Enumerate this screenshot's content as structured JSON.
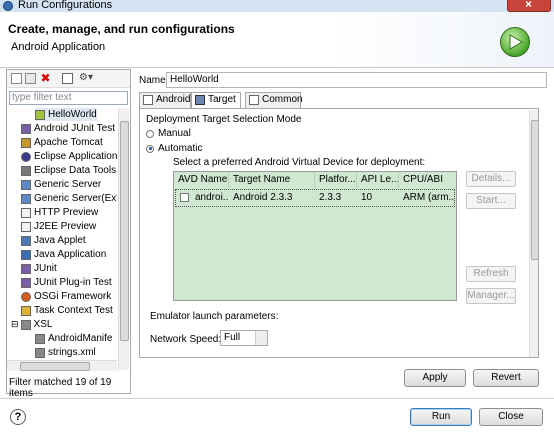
{
  "window": {
    "title": "Run Configurations"
  },
  "header": {
    "title": "Create, manage, and run configurations",
    "subtitle": "Android Application",
    "icon": "run-icon"
  },
  "sidebar": {
    "filter_placeholder": "type filter text",
    "toolbar_icons": [
      "new-config-icon",
      "duplicate-icon",
      "delete-icon",
      "collapse-all-icon",
      "filter-icon"
    ],
    "items": [
      {
        "label": "HelloWorld",
        "icon": "android-app-icon",
        "indent": 2,
        "selected": true
      },
      {
        "label": "Android JUnit Test",
        "icon": "junit-icon",
        "indent": 1
      },
      {
        "label": "Apache Tomcat",
        "icon": "tomcat-icon",
        "indent": 1
      },
      {
        "label": "Eclipse Application",
        "icon": "eclipse-icon",
        "indent": 1
      },
      {
        "label": "Eclipse Data Tools",
        "icon": "database-icon",
        "indent": 1
      },
      {
        "label": "Generic Server",
        "icon": "server-icon",
        "indent": 1
      },
      {
        "label": "Generic Server(Exte",
        "icon": "server-icon",
        "indent": 1
      },
      {
        "label": "HTTP Preview",
        "icon": "page-icon",
        "indent": 1
      },
      {
        "label": "J2EE Preview",
        "icon": "page-icon",
        "indent": 1
      },
      {
        "label": "Java Applet",
        "icon": "applet-icon",
        "indent": 1
      },
      {
        "label": "Java Application",
        "icon": "java-app-icon",
        "indent": 1
      },
      {
        "label": "JUnit",
        "icon": "junit-icon",
        "indent": 1
      },
      {
        "label": "JUnit Plug-in Test",
        "icon": "junit-icon",
        "indent": 1
      },
      {
        "label": "OSGi Framework",
        "icon": "osgi-icon",
        "indent": 1
      },
      {
        "label": "Task Context Test",
        "icon": "task-icon",
        "indent": 1
      },
      {
        "label": "XSL",
        "icon": "xsl-icon",
        "indent": 0,
        "expander": "⊟"
      },
      {
        "label": "AndroidManife",
        "icon": "xsl-icon",
        "indent": 2
      },
      {
        "label": "strings.xml",
        "icon": "xsl-icon",
        "indent": 2
      }
    ],
    "status": "Filter matched 19 of 19 items"
  },
  "config": {
    "name_label": "Name:",
    "name_value": "HelloWorld",
    "tabs": [
      {
        "label": "Android",
        "icon": "android-tab-icon",
        "active": false
      },
      {
        "label": "Target",
        "icon": "target-tab-icon",
        "active": true
      },
      {
        "label": "Common",
        "icon": "common-tab-icon",
        "active": false
      }
    ],
    "target": {
      "group_title": "Deployment Target Selection Mode",
      "manual_label": "Manual",
      "automatic_label": "Automatic",
      "mode": "Automatic",
      "avd_prompt": "Select a preferred Android Virtual Device for deployment:",
      "columns": [
        "AVD Name",
        "Target Name",
        "Platfor...",
        "API Le...",
        "CPU/ABI"
      ],
      "rows": [
        [
          "androi...",
          "Android 2.3.3",
          "2.3.3",
          "10",
          "ARM (arm..."
        ]
      ],
      "buttons": {
        "details": "Details...",
        "start": "Start...",
        "refresh": "Refresh",
        "manager": "Manager..."
      },
      "emulator_label": "Emulator launch parameters:",
      "network_speed_label": "Network Speed:",
      "network_speed_value": "Full"
    }
  },
  "footer": {
    "apply": "Apply",
    "revert": "Revert",
    "run": "Run",
    "close": "Close",
    "help": "?"
  }
}
